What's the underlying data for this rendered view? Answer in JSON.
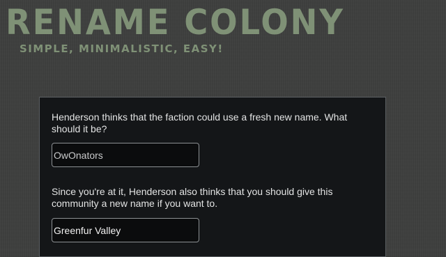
{
  "header": {
    "title": "Rename Colony",
    "subtitle": "Simple, minimalistic, easy!"
  },
  "form": {
    "faction_prompt": "Henderson thinks that the faction could use a fresh new name. What should it be?",
    "faction_name_value": "OwOnators",
    "community_prompt": "Since you're at it, Henderson also thinks that you should give this community a new name if you want to.",
    "community_name_value": "Greenfur Valley"
  },
  "colors": {
    "title_accent": "#7f9176",
    "panel_background": "#141618",
    "page_background": "#3d3e3d"
  }
}
